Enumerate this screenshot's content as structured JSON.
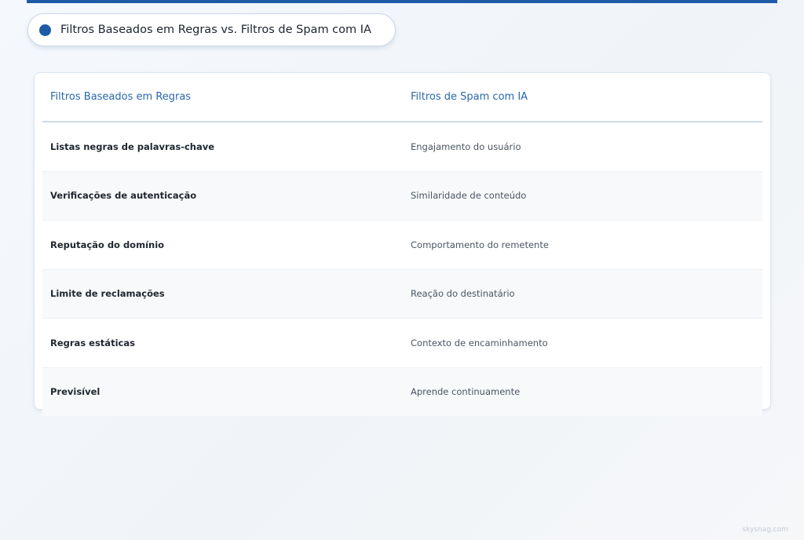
{
  "header": {
    "title": "Filtros Baseados em Regras vs. Filtros de Spam com IA"
  },
  "table": {
    "columns": [
      "Filtros Baseados em Regras",
      "Filtros de Spam com IA"
    ],
    "rows": [
      [
        "Listas negras de palavras-chave",
        "Engajamento do usuário"
      ],
      [
        "Verificações de autenticação",
        "Similaridade de conteúdo"
      ],
      [
        "Reputação do domínio",
        "Comportamento do remetente"
      ],
      [
        "Limite de reclamações",
        "Reação do destinatário"
      ],
      [
        "Regras estáticas",
        "Contexto de encaminhamento"
      ],
      [
        "Previsível",
        "Aprende continuamente"
      ]
    ]
  },
  "footer": {
    "watermark": "skysnag.com"
  },
  "colors": {
    "accent": "#1d5ba6",
    "header_text": "#2867ad"
  }
}
